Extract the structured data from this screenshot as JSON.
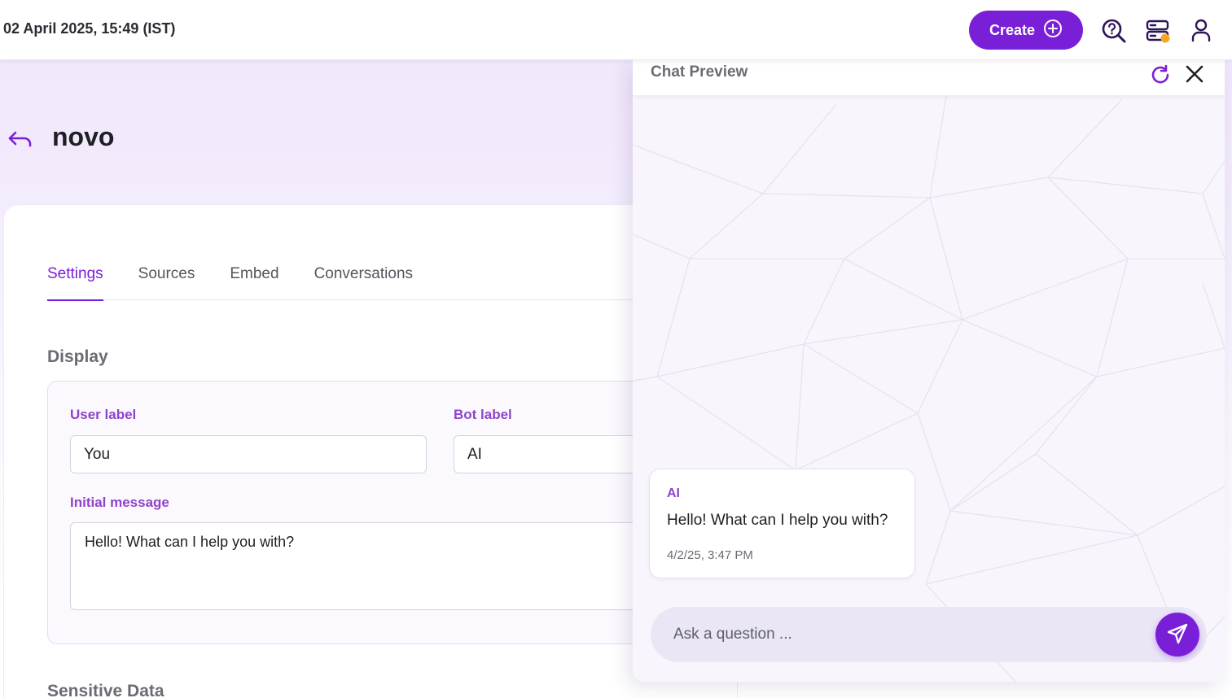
{
  "header": {
    "datetime": "02 April 2025, 15:49 (IST)",
    "create_label": "Create",
    "icons": [
      "search-help-icon",
      "server-status-icon",
      "user-icon"
    ],
    "status_dot_color": "#f5a623"
  },
  "page": {
    "title": "novo",
    "back_icon": "back-arrow-icon"
  },
  "tabs": [
    {
      "label": "Settings",
      "active": true
    },
    {
      "label": "Sources",
      "active": false
    },
    {
      "label": "Embed",
      "active": false
    },
    {
      "label": "Conversations",
      "active": false
    }
  ],
  "display": {
    "section_title": "Display",
    "user_label": {
      "label": "User label",
      "value": "You"
    },
    "bot_label": {
      "label": "Bot label",
      "value": "AI"
    },
    "initial_message": {
      "label": "Initial message",
      "value": "Hello! What can I help you with?"
    }
  },
  "sensitive_section_title": "Sensitive Data",
  "chat_preview": {
    "title": "Chat Preview",
    "messages": [
      {
        "sender": "AI",
        "text": "Hello! What can I help you with?",
        "time": "4/2/25, 3:47 PM"
      }
    ],
    "input_placeholder": "Ask a question ..."
  },
  "colors": {
    "accent": "#7a1fd8",
    "label": "#8e44c9"
  }
}
